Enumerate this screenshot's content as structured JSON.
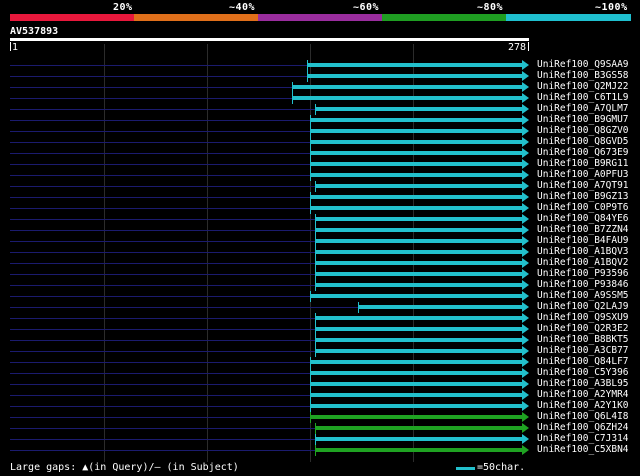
{
  "scale": {
    "labels": [
      "20%",
      "~40%",
      "~60%",
      "~80%",
      "~100%"
    ],
    "colors": [
      "#e8183c",
      "#e06f1a",
      "#9a2d9e",
      "#1f9e22",
      "#1fbfcf"
    ]
  },
  "query": {
    "id": "AV537893",
    "start": "1",
    "end": "278"
  },
  "hits": [
    {
      "label": "UniRef100_Q9SAA9",
      "start": 0.58,
      "color": "#22c0cc"
    },
    {
      "label": "UniRef100_B3GS58",
      "start": 0.58,
      "color": "#22c0cc"
    },
    {
      "label": "UniRef100_Q2MJ22",
      "start": 0.55,
      "color": "#22c0cc"
    },
    {
      "label": "UniRef100_C6T1L9",
      "start": 0.55,
      "color": "#22c0cc"
    },
    {
      "label": "UniRef100_A7QLM7",
      "start": 0.595,
      "color": "#22c0cc"
    },
    {
      "label": "UniRef100_B9GMU7",
      "start": 0.585,
      "color": "#22c0cc"
    },
    {
      "label": "UniRef100_Q8GZV0",
      "start": 0.585,
      "color": "#22c0cc"
    },
    {
      "label": "UniRef100_Q8GVD5",
      "start": 0.585,
      "color": "#22c0cc"
    },
    {
      "label": "UniRef100_Q673E9",
      "start": 0.585,
      "color": "#22c0cc"
    },
    {
      "label": "UniRef100_B9RG11",
      "start": 0.585,
      "color": "#22c0cc"
    },
    {
      "label": "UniRef100_A0PFU3",
      "start": 0.585,
      "color": "#22c0cc"
    },
    {
      "label": "UniRef100_A7QT91",
      "start": 0.595,
      "color": "#22c0cc"
    },
    {
      "label": "UniRef100_B9GZ13",
      "start": 0.585,
      "color": "#22c0cc"
    },
    {
      "label": "UniRef100_C0P9T6",
      "start": 0.585,
      "color": "#22c0cc"
    },
    {
      "label": "UniRef100_Q84YE6",
      "start": 0.595,
      "color": "#22c0cc"
    },
    {
      "label": "UniRef100_B7ZZN4",
      "start": 0.595,
      "color": "#22c0cc"
    },
    {
      "label": "UniRef100_B4FAU9",
      "start": 0.595,
      "color": "#22c0cc"
    },
    {
      "label": "UniRef100_A1BQV3",
      "start": 0.595,
      "color": "#22c0cc"
    },
    {
      "label": "UniRef100_A1BQV2",
      "start": 0.595,
      "color": "#22c0cc"
    },
    {
      "label": "UniRef100_P93596",
      "start": 0.595,
      "color": "#22c0cc"
    },
    {
      "label": "UniRef100_P93846",
      "start": 0.595,
      "color": "#22c0cc"
    },
    {
      "label": "UniRef100_A9SSM5",
      "start": 0.585,
      "color": "#22c0cc"
    },
    {
      "label": "UniRef100_Q2LAJ9",
      "start": 0.68,
      "color": "#22c0cc"
    },
    {
      "label": "UniRef100_Q9SXU9",
      "start": 0.595,
      "color": "#22c0cc"
    },
    {
      "label": "UniRef100_Q2R3E2",
      "start": 0.595,
      "color": "#22c0cc"
    },
    {
      "label": "UniRef100_B8BKT5",
      "start": 0.595,
      "color": "#22c0cc"
    },
    {
      "label": "UniRef100_A3CB77",
      "start": 0.595,
      "color": "#22c0cc"
    },
    {
      "label": "UniRef100_Q84LF7",
      "start": 0.585,
      "color": "#22c0cc"
    },
    {
      "label": "UniRef100_C5Y396",
      "start": 0.585,
      "color": "#22c0cc"
    },
    {
      "label": "UniRef100_A3BL95",
      "start": 0.585,
      "color": "#22c0cc"
    },
    {
      "label": "UniRef100_A2YMR4",
      "start": 0.585,
      "color": "#22c0cc"
    },
    {
      "label": "UniRef100_A2Y1K0",
      "start": 0.585,
      "color": "#22c0cc"
    },
    {
      "label": "UniRef100_Q6L4I8",
      "start": 0.585,
      "color": "#1fa322"
    },
    {
      "label": "UniRef100_Q6ZH24",
      "start": 0.595,
      "color": "#1fa322"
    },
    {
      "label": "UniRef100_C7J314",
      "start": 0.595,
      "color": "#22c0cc"
    },
    {
      "label": "UniRef100_C5XBN4",
      "start": 0.595,
      "color": "#1fa322"
    }
  ],
  "footer": {
    "gaps_text": "Large gaps: ▲(in Query)/— (in Subject)",
    "legend_text": "=50char."
  }
}
